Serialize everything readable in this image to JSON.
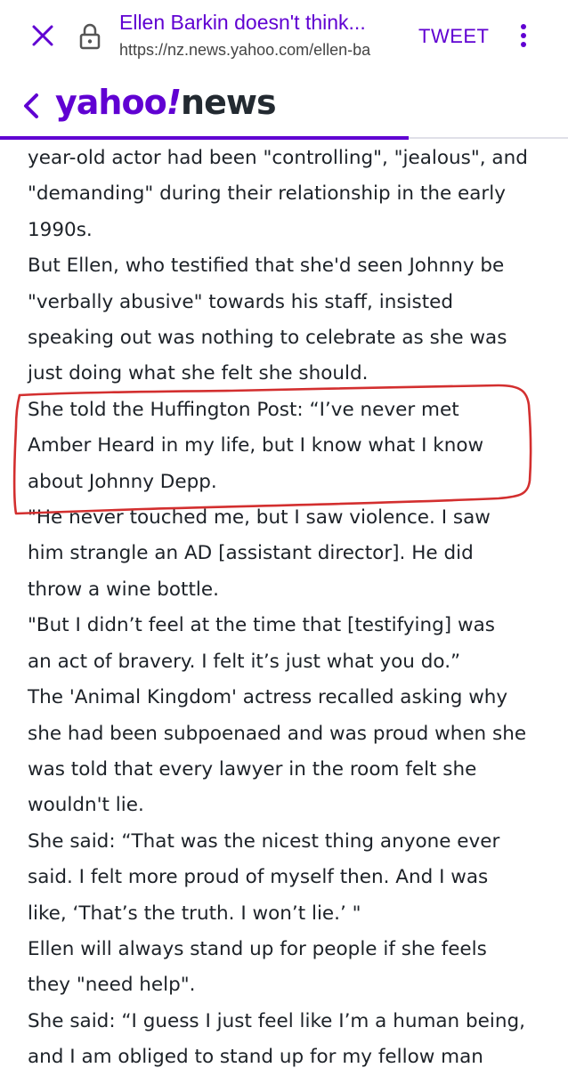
{
  "browser": {
    "page_title": "Ellen Barkin doesn't think...",
    "url": "https://nz.news.yahoo.com/ellen-ba",
    "tweet_label": "TWEET"
  },
  "header": {
    "logo_yahoo": "yahoo",
    "logo_bang": "!",
    "logo_news": "news"
  },
  "reading_progress": 0.72,
  "colors": {
    "brand_purple": "#6001d2",
    "text": "#1d2228",
    "annotation_red": "#d32f2f"
  },
  "article": {
    "lines": [
      "year-old actor had been \"controlling\", \"jealous\", and",
      "\"demanding\" during their relationship in the early",
      "1990s.",
      "But Ellen, who testified that she'd seen Johnny be",
      "\"verbally abusive\" towards his staff, insisted",
      "speaking out was nothing to celebrate as she was",
      "just doing what she felt she should.",
      "She told the Huffington Post: “I’ve never met",
      "Amber Heard in my life, but I know what I know",
      "about Johnny Depp.",
      "\"He never touched me, but I saw violence. I saw",
      "him strangle an AD [assistant director]. He did",
      "throw a wine bottle.",
      "\"But I didn’t feel at the time that [testifying] was",
      "an act of bravery. I felt it’s just what you do.”",
      "The 'Animal Kingdom' actress recalled asking why",
      "she had been subpoenaed and was proud when she",
      "was told that every lawyer in the room felt she",
      "wouldn't lie.",
      "She said: “That was the nicest thing anyone ever",
      "said. I felt more proud of myself then. And I was",
      "like, ‘That’s the truth. I won’t lie.’ \"",
      "Ellen will always stand up for people if she feels",
      "they \"need help\".",
      "She said: “I guess I just feel like I’m a human being,",
      "and I am obliged to stand up for my fellow man"
    ]
  }
}
